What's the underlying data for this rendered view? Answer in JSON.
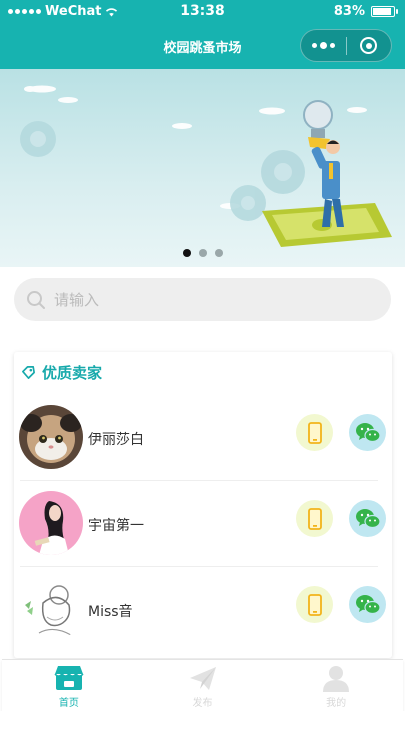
{
  "status_bar": {
    "carrier": "WeChat",
    "time": "13:38",
    "battery": "83%",
    "battery_level": 0.83
  },
  "nav": {
    "title": "校园跳蚤市场",
    "more_icon": "more-dots-icon",
    "close_icon": "target-circle-icon"
  },
  "banner": {
    "page_count": 3,
    "active_page": 1
  },
  "search": {
    "placeholder": "请输入",
    "value": ""
  },
  "sellers": {
    "title": "优质卖家",
    "items": [
      {
        "name": "伊丽莎白",
        "avatar": "cat-avatar",
        "phone_icon": "phone-icon",
        "wechat_icon": "wechat-icon"
      },
      {
        "name": "宇宙第一",
        "avatar": "girl-pink-avatar",
        "phone_icon": "phone-icon",
        "wechat_icon": "wechat-icon"
      },
      {
        "name": "Miss音",
        "avatar": "sketch-girl-avatar",
        "phone_icon": "phone-icon",
        "wechat_icon": "wechat-icon"
      }
    ]
  },
  "tabbar": {
    "items": [
      {
        "label": "首页",
        "icon": "shop-icon",
        "active": true
      },
      {
        "label": "发布",
        "icon": "paper-plane-icon",
        "active": false
      },
      {
        "label": "我的",
        "icon": "user-icon",
        "active": false
      }
    ]
  },
  "colors": {
    "accent": "#17b3b0",
    "seller_title": "#17a9ab",
    "phone_bg": "#f2f8d0",
    "wechat_bg": "#bfe7f1",
    "wechat_green": "#35b34a"
  }
}
